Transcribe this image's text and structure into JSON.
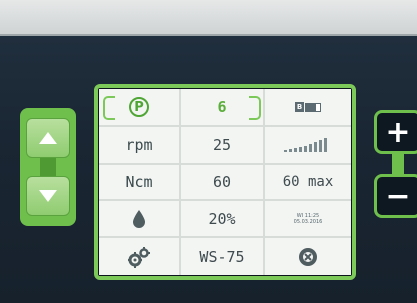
{
  "panel": {
    "program": {
      "label": "P",
      "number": "6"
    },
    "speed": {
      "label": "rpm",
      "value": "25"
    },
    "torque": {
      "label": "Ncm",
      "value": "60",
      "max_text": "60 max"
    },
    "irrigation": {
      "value": "20%"
    },
    "handpiece": {
      "model": "WS-75"
    },
    "status": {
      "battery_label": "B",
      "date_top": "WI 11:25",
      "date_bottom": "05.03.2016"
    },
    "controls": {
      "plus_label": "+",
      "minus_label": "−"
    }
  },
  "colors": {
    "accent_green": "#7cc95a",
    "screen_bg": "#f3f5f3",
    "bezel": "#1b2733"
  },
  "icons": {
    "program": "program-p-icon",
    "drop": "water-drop-icon",
    "gears": "gears-icon",
    "battery": "battery-icon",
    "signal": "signal-bars-icon",
    "logo": "round-logo-icon",
    "up": "arrow-up-icon",
    "down": "arrow-down-icon"
  }
}
